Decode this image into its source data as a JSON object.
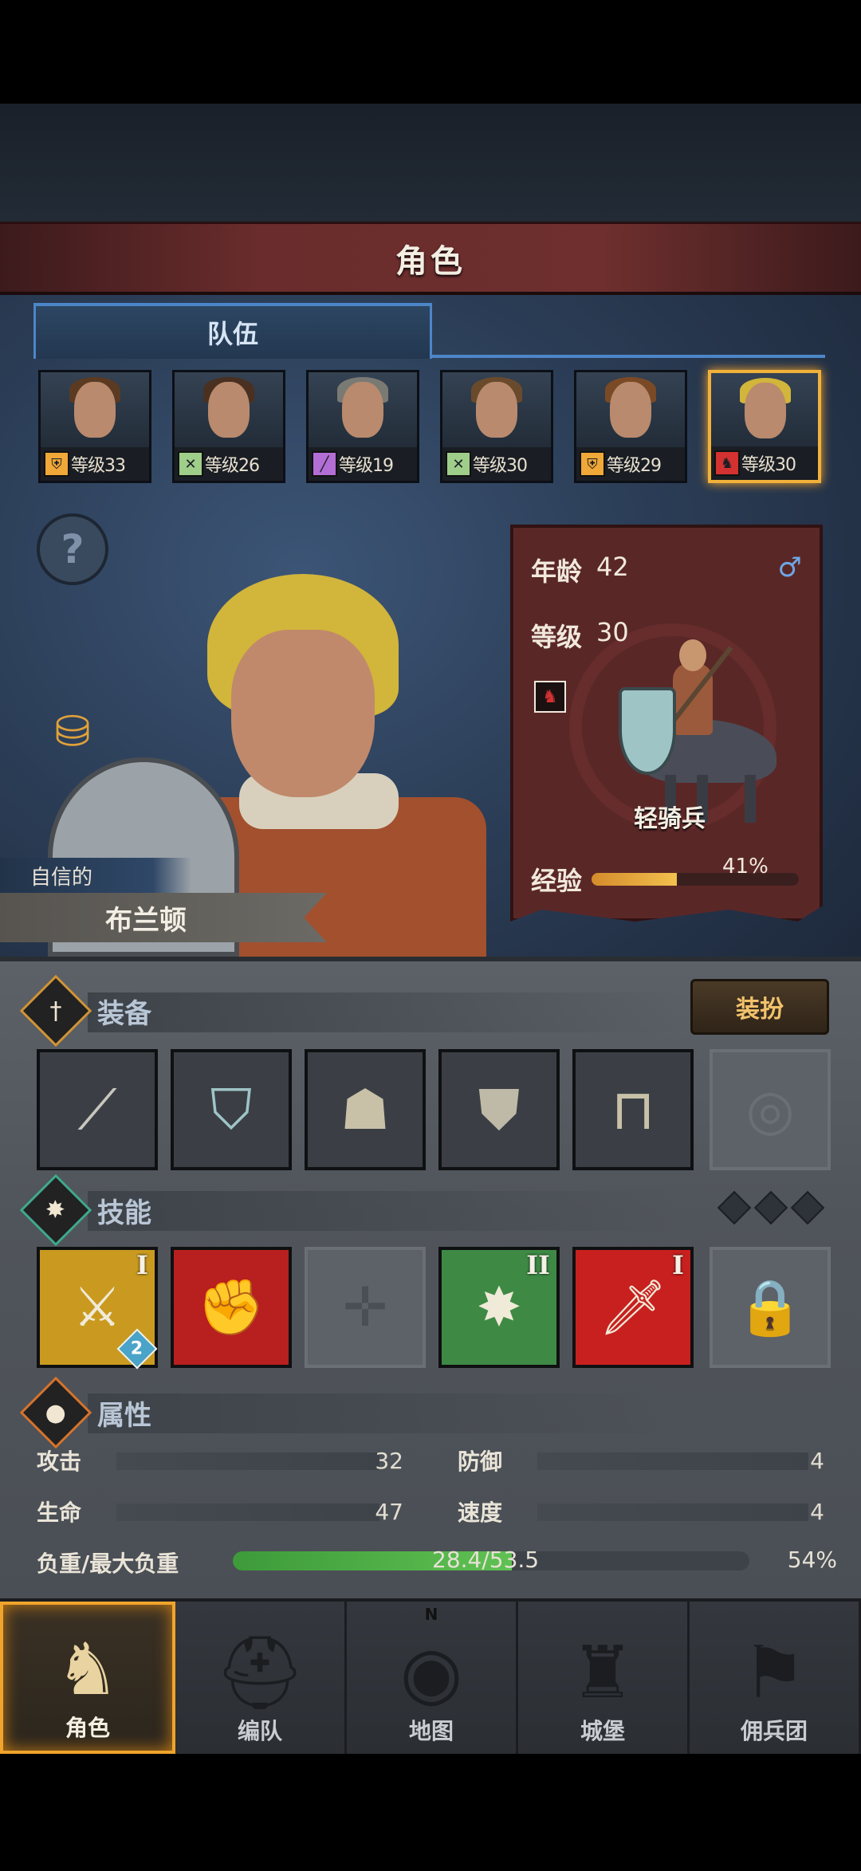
{
  "header": {
    "title": "角色"
  },
  "team": {
    "tab_label": "队伍",
    "members": [
      {
        "level_label": "等级33",
        "class_icon": "shield-icon",
        "class_color": "#f0a838",
        "hair": "#5b3a22",
        "selected": false
      },
      {
        "level_label": "等级26",
        "class_icon": "crossed-swords-icon",
        "class_color": "#9fce8a",
        "hair": "#4a3020",
        "selected": false
      },
      {
        "level_label": "等级19",
        "class_icon": "staff-icon",
        "class_color": "#b36ed6",
        "hair": "#7a7a74",
        "selected": false
      },
      {
        "level_label": "等级30",
        "class_icon": "crossed-swords-icon",
        "class_color": "#9fce8a",
        "hair": "#6a4a2c",
        "selected": false
      },
      {
        "level_label": "等级29",
        "class_icon": "shield-icon",
        "class_color": "#f0a838",
        "hair": "#7a4a26",
        "selected": false
      },
      {
        "level_label": "等级30",
        "class_icon": "horse-icon",
        "class_color": "#d43131",
        "hair": "#d2b53b",
        "selected": true
      }
    ]
  },
  "hero": {
    "trait": "自信的",
    "name": "布兰顿"
  },
  "card": {
    "age_label": "年龄",
    "age_value": "42",
    "gender_icon": "male-icon",
    "level_label": "等级",
    "level_value": "30",
    "unit_class": "轻骑兵",
    "xp_label": "经验",
    "xp_text": "41%",
    "xp_fraction": 0.41
  },
  "equipment": {
    "title": "装备",
    "dress_button": "装扮",
    "slots": [
      {
        "name": "spear-icon",
        "glyph": "⟋",
        "color": "#c9c6bf"
      },
      {
        "name": "kite-shield-icon",
        "glyph": "⛉",
        "color": "#9ec4c6"
      },
      {
        "name": "hood-icon",
        "glyph": "☗",
        "color": "#c8c1a8"
      },
      {
        "name": "chainmail-icon",
        "glyph": "⛊",
        "color": "#bfbaa8"
      },
      {
        "name": "boots-icon",
        "glyph": "⊓",
        "color": "#c8c1a8"
      },
      {
        "name": "ring-slot-icon",
        "glyph": "◎",
        "color": "#6a6f76",
        "empty": true
      }
    ]
  },
  "skills": {
    "title": "技能",
    "items": [
      {
        "name": "sword-strike-skill-icon",
        "glyph": "⚔",
        "bg": "#c99a1f",
        "rank": "I",
        "stack": "2"
      },
      {
        "name": "bash-skill-icon",
        "glyph": "✊",
        "bg": "#b81f1f",
        "rank": "",
        "stack": ""
      },
      {
        "name": "empty-skill-slot-icon",
        "glyph": "✛",
        "bg": "",
        "rank": "",
        "stack": "",
        "empty": true
      },
      {
        "name": "burst-skill-icon",
        "glyph": "✸",
        "bg": "#3e8a45",
        "rank": "II",
        "stack": ""
      },
      {
        "name": "blade-skill-icon",
        "glyph": "🗡",
        "bg": "#c8201f",
        "rank": "I",
        "stack": ""
      },
      {
        "name": "locked-skill-icon",
        "glyph": "🔒",
        "bg": "",
        "rank": "",
        "stack": "",
        "empty": true
      }
    ]
  },
  "attributes": {
    "title": "属性",
    "attack_label": "攻击",
    "attack_value": "32",
    "defense_label": "防御",
    "defense_value": "4",
    "hp_label": "生命",
    "hp_value": "47",
    "speed_label": "速度",
    "speed_value": "4",
    "load_label": "负重/最大负重",
    "load_text": "28.4/53.5",
    "load_pct": "54%",
    "load_fraction": 0.54
  },
  "nav": {
    "items": [
      {
        "label": "角色",
        "icon": "knight-icon",
        "active": true
      },
      {
        "label": "编队",
        "icon": "helmet-icon",
        "active": false
      },
      {
        "label": "地图",
        "icon": "compass-map-icon",
        "active": false,
        "north": "N"
      },
      {
        "label": "城堡",
        "icon": "castle-icon",
        "active": false
      },
      {
        "label": "佣兵团",
        "icon": "mercenary-icon",
        "active": false
      }
    ]
  },
  "colors": {
    "accent": "#f0a42b",
    "tab_blue": "#4d86c8",
    "banner_red": "#6a2c2c"
  }
}
